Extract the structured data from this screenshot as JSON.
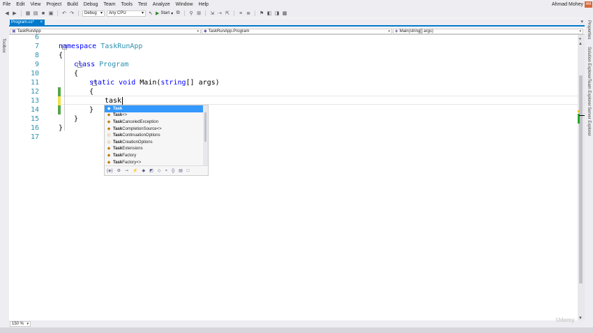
{
  "menu": [
    "File",
    "Edit",
    "View",
    "Project",
    "Build",
    "Debug",
    "Team",
    "Tools",
    "Test",
    "Analyze",
    "Window",
    "Help"
  ],
  "user": {
    "name": "Ahmad Mohey",
    "initials": "AM"
  },
  "toolbar": {
    "config": "Debug",
    "platform": "Any CPU",
    "start_label": "Start"
  },
  "side_panels": {
    "left": "Toolbox",
    "right": [
      "Properties",
      "Solution Explorer",
      "Team Explorer",
      "Server Explorer"
    ]
  },
  "document_tab": {
    "title": "Program.cs*",
    "close": "×"
  },
  "navigation": {
    "project": "TaskRunApp",
    "type": "TaskRunApp.Program",
    "member": "Main(string[] args)"
  },
  "code_lines": [
    {
      "n": "6",
      "t": ""
    },
    {
      "n": "7",
      "t": "namespace TaskRunApp"
    },
    {
      "n": "8",
      "t": "{"
    },
    {
      "n": "9",
      "t": "class Program"
    },
    {
      "n": "10",
      "t": "{"
    },
    {
      "n": "11",
      "t": "static void Main(string[] args)"
    },
    {
      "n": "12",
      "t": "{"
    },
    {
      "n": "13",
      "t": "task"
    },
    {
      "n": "14",
      "t": "}"
    },
    {
      "n": "15",
      "t": "}"
    },
    {
      "n": "16",
      "t": "}"
    },
    {
      "n": "17",
      "t": ""
    }
  ],
  "code_tokens": {
    "namespace_kw": "namespace",
    "namespace_name": "TaskRunApp",
    "class_kw": "class",
    "class_name": "Program",
    "static_kw": "static",
    "void_kw": "void",
    "main_name": "Main(",
    "string_kw": "string",
    "args_rest": "[] args)",
    "open_brace": "{",
    "close_brace": "}",
    "typed": "task"
  },
  "autocomplete": {
    "items": [
      {
        "bold": "Task",
        "rest": ""
      },
      {
        "bold": "Task",
        "rest": "<>"
      },
      {
        "bold": "Task",
        "rest": "CanceledException"
      },
      {
        "bold": "Task",
        "rest": "CompletionSource<>"
      },
      {
        "bold": "Task",
        "rest": "ContinuationOptions"
      },
      {
        "bold": "Task",
        "rest": "CreationOptions"
      },
      {
        "bold": "Task",
        "rest": "Extensions"
      },
      {
        "bold": "Task",
        "rest": "Factory"
      },
      {
        "bold": "Task",
        "rest": "Factory<>"
      }
    ],
    "selected_index": 0
  },
  "zoom": "150 %",
  "watermark": "Udemy"
}
